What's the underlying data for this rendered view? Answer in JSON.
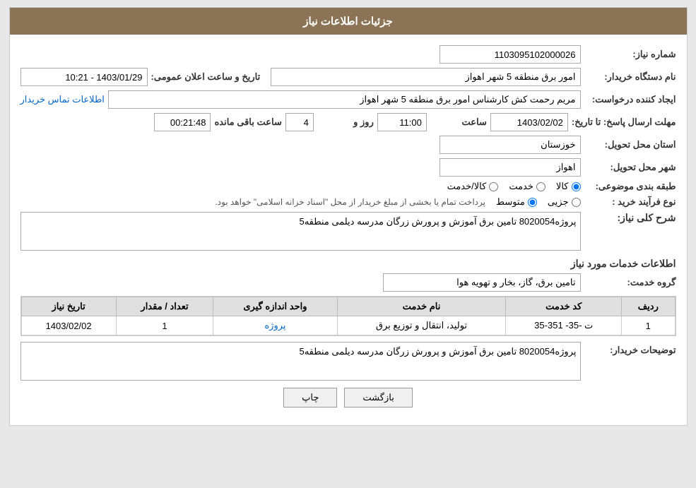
{
  "header": {
    "title": "جزئیات اطلاعات نیاز"
  },
  "form": {
    "need_number_label": "شماره نیاز:",
    "need_number_value": "1103095102000026",
    "buyer_org_label": "نام دستگاه خریدار:",
    "buyer_org_value": "امور برق منطقه 5 شهر اهواز",
    "announce_datetime_label": "تاریخ و ساعت اعلان عمومی:",
    "announce_datetime_value": "1403/01/29 - 10:21",
    "creator_label": "ایجاد کننده درخواست:",
    "creator_value": "مریم رحمت کش کارشناس امور برق منطقه 5 شهر اهواز",
    "contact_link": "اطلاعات تماس خریدار",
    "response_deadline_label": "مهلت ارسال پاسخ: تا تاریخ:",
    "response_date": "1403/02/02",
    "response_time_label": "ساعت",
    "response_time": "11:00",
    "response_days_label": "روز و",
    "response_days": "4",
    "response_remaining_label": "ساعت باقی مانده",
    "response_remaining": "00:21:48",
    "province_label": "استان محل تحویل:",
    "province_value": "خوزستان",
    "city_label": "شهر محل تحویل:",
    "city_value": "اهواز",
    "category_label": "طبقه بندی موضوعی:",
    "category_options": [
      {
        "id": "kala",
        "label": "کالا"
      },
      {
        "id": "khadamat",
        "label": "خدمت"
      },
      {
        "id": "kala_khadamat",
        "label": "کالا/خدمت"
      }
    ],
    "category_selected": "kala",
    "purchase_type_label": "نوع فرآیند خرید :",
    "purchase_type_options": [
      {
        "id": "jozii",
        "label": "جزیی"
      },
      {
        "id": "motavaset",
        "label": "متوسط"
      }
    ],
    "purchase_type_selected": "motavaset",
    "purchase_type_note": "پرداخت تمام یا بخشی از مبلغ خریدار از محل \"اسناد خزانه اسلامی\" خواهد بود."
  },
  "need_description": {
    "section_title": "شرح کلی نیاز:",
    "value": "پروژه8020054 تامین برق آموزش و پرورش زرگان مدرسه دیلمی منطقه5"
  },
  "services_section": {
    "title": "اطلاعات خدمات مورد نیاز",
    "service_group_label": "گروه خدمت:",
    "service_group_value": "تامین برق، گاز، بخار و تهویه هوا",
    "table": {
      "columns": [
        "ردیف",
        "کد خدمت",
        "نام خدمت",
        "واحد اندازه گیری",
        "تعداد / مقدار",
        "تاریخ نیاز"
      ],
      "rows": [
        {
          "row_num": "1",
          "code": "ت -35- 351-35",
          "name": "تولید، انتقال و توزیع برق",
          "unit": "پروژه",
          "quantity": "1",
          "date": "1403/02/02"
        }
      ]
    },
    "buyer_desc_label": "توضیحات خریدار:",
    "buyer_desc_value": "پروژه8020054 تامین برق آموزش و پرورش زرگان مدرسه دیلمی منطقه5"
  },
  "buttons": {
    "print": "چاپ",
    "back": "بازگشت"
  }
}
